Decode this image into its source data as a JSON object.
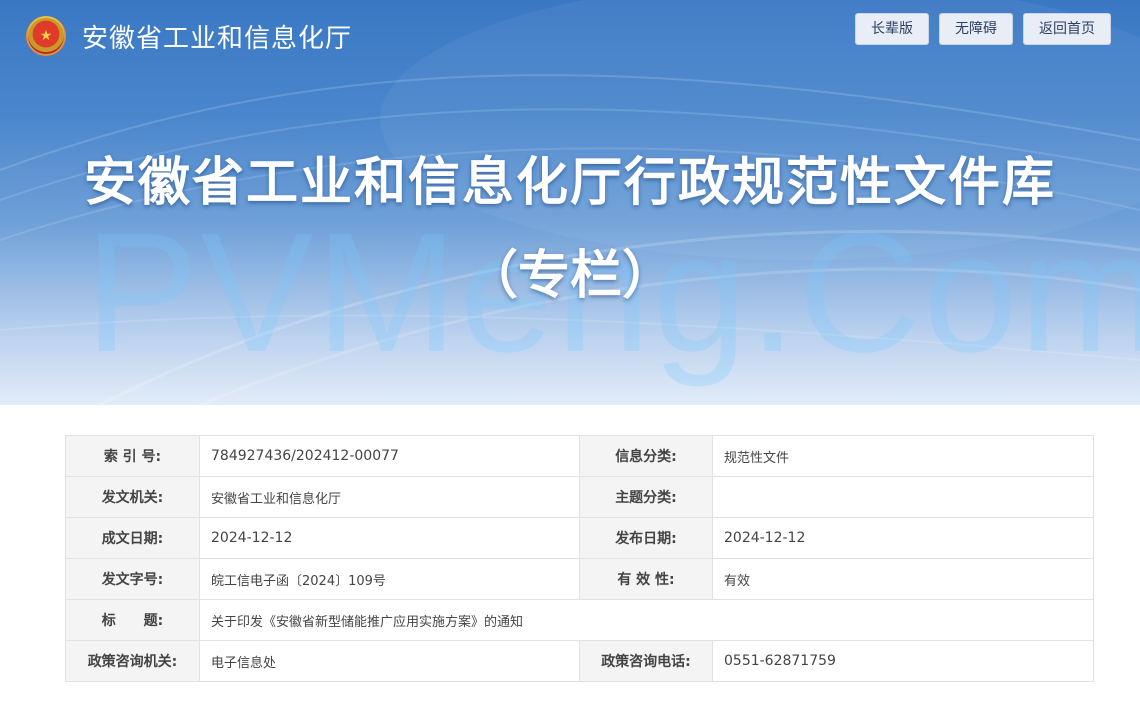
{
  "header": {
    "site_name": "安徽省工业和信息化厅",
    "emblem_icon": "national-emblem-icon",
    "buttons": [
      "长辈版",
      "无障碍",
      "返回首页"
    ]
  },
  "banner": {
    "title": "安徽省工业和信息化厅行政规范性文件库",
    "subtitle": "（专栏）",
    "watermark": "PVMeng.Com"
  },
  "info_table": {
    "rows": [
      [
        {
          "label": "索 引 号:",
          "value": "784927436/202412-00077"
        },
        {
          "label": "信息分类:",
          "value": "规范性文件"
        }
      ],
      [
        {
          "label": "发文机关:",
          "value": "安徽省工业和信息化厅"
        },
        {
          "label": "主题分类:",
          "value": ""
        }
      ],
      [
        {
          "label": "成文日期:",
          "value": "2024-12-12"
        },
        {
          "label": "发布日期:",
          "value": "2024-12-12"
        }
      ],
      [
        {
          "label": "发文字号:",
          "value": "皖工信电子函〔2024〕109号"
        },
        {
          "label": "有 效 性:",
          "value": "有效"
        }
      ],
      [
        {
          "label": "标　　题:",
          "value": "关于印发《安徽省新型储能推广应用实施方案》的通知"
        }
      ],
      [
        {
          "label": "政策咨询机关:",
          "value": "电子信息处"
        },
        {
          "label": "政策咨询电话:",
          "value": "0551-62871759"
        }
      ]
    ]
  },
  "colors": {
    "banner_top": "#3a78c4",
    "banner_bottom": "#e3ecf8",
    "label_bg": "#f4f4f4",
    "border": "#e2e2e2"
  }
}
